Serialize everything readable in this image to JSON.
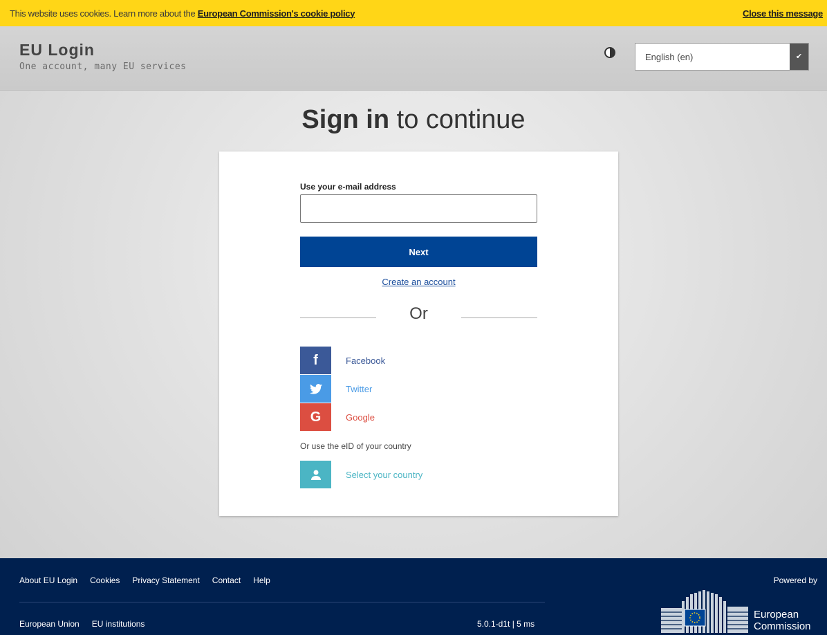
{
  "cookie_bar": {
    "text": "This website uses cookies. Learn more about the",
    "link": "European Commission's cookie policy",
    "close": "Close this message"
  },
  "header": {
    "title": "EU Login",
    "subtitle": "One account, many EU services",
    "language": "English (en)"
  },
  "main": {
    "heading_bold": "Sign in",
    "heading_rest": "to continue",
    "email_label": "Use your e-mail address",
    "email_value": "",
    "next_label": "Next",
    "create_account": "Create an account",
    "or_text": "Or",
    "social": [
      {
        "label": "Facebook",
        "icon": "facebook-icon",
        "glyph": "f"
      },
      {
        "label": "Twitter",
        "icon": "twitter-icon",
        "glyph": "t"
      },
      {
        "label": "Google",
        "icon": "google-icon",
        "glyph": "G"
      }
    ],
    "eid_label": "Or use the eID of your country",
    "select_country": "Select your country"
  },
  "footer": {
    "links": [
      "About EU Login",
      "Cookies",
      "Privacy Statement",
      "Contact",
      "Help"
    ],
    "bottom_links": [
      "European Union",
      "EU institutions"
    ],
    "version": "5.0.1-d1t | 5 ms",
    "powered_by": "Powered by",
    "ec_line1": "European",
    "ec_line2": "Commission"
  },
  "colors": {
    "accent": "#004494",
    "cookie_bar": "#ffd617",
    "footer": "#00204f",
    "facebook": "#3b5998",
    "twitter": "#4a9be6",
    "google": "#dc4e41",
    "eid": "#4bb5c4"
  }
}
